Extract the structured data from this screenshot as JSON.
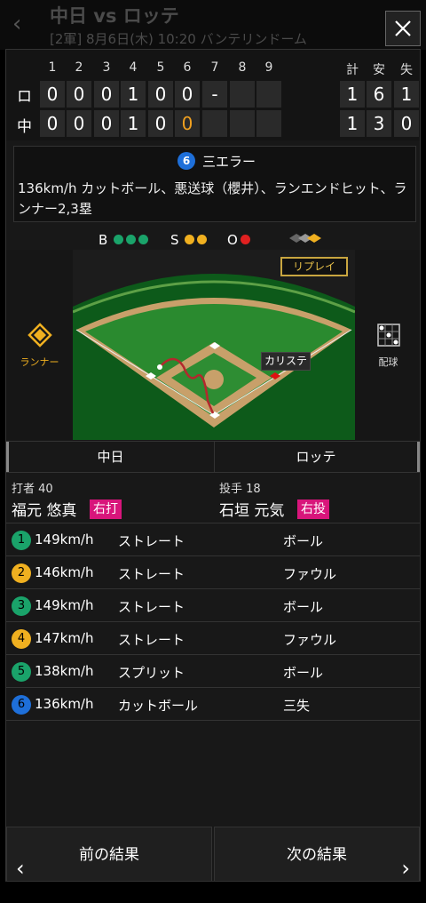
{
  "background": {
    "title": "中日 vs ロッテ",
    "subtitle": "[2軍] 8月6日(木) 10:20 バンテリンドーム",
    "back_icon": "chevron-left-icon"
  },
  "close_label": "×",
  "scoreboard": {
    "innings": [
      "1",
      "2",
      "3",
      "4",
      "5",
      "6",
      "7",
      "8",
      "9"
    ],
    "totals_headers": [
      "計",
      "安",
      "失"
    ],
    "teams": [
      {
        "abbr": "ロ",
        "scores": [
          "0",
          "0",
          "0",
          "1",
          "0",
          "0",
          "-",
          "",
          ""
        ],
        "totals": [
          "1",
          "6",
          "1"
        ]
      },
      {
        "abbr": "中",
        "scores": [
          "0",
          "0",
          "0",
          "1",
          "0",
          "0",
          "",
          "",
          ""
        ],
        "totals": [
          "1",
          "3",
          "0"
        ],
        "highlight_index": 5
      }
    ]
  },
  "play": {
    "number": "6",
    "result": "三エラー",
    "description": "136km/h カットボール、悪送球（櫻井）、ランエンドヒット、ランナー2,3塁"
  },
  "count": {
    "b_label": "B",
    "s_label": "S",
    "o_label": "O",
    "balls": 3,
    "strikes": 2,
    "outs": 1
  },
  "field": {
    "replay_label": "リプレイ",
    "runner_label": "ランナー",
    "pitch_chart_label": "配球",
    "fielder_tag": "カリステ"
  },
  "tabs": [
    "中日",
    "ロッテ"
  ],
  "batter": {
    "role": "打者",
    "number": "40",
    "name": "福元 悠真",
    "hand": "右打"
  },
  "pitcher": {
    "role": "投手",
    "number": "18",
    "name": "石垣 元気",
    "hand": "右投"
  },
  "pitches": [
    {
      "num": "1",
      "speed": "149km/h",
      "type": "ストレート",
      "result": "ボール",
      "color": "#1aa36a"
    },
    {
      "num": "2",
      "speed": "146km/h",
      "type": "ストレート",
      "result": "ファウル",
      "color": "#f0b020"
    },
    {
      "num": "3",
      "speed": "149km/h",
      "type": "ストレート",
      "result": "ボール",
      "color": "#1aa36a"
    },
    {
      "num": "4",
      "speed": "147km/h",
      "type": "ストレート",
      "result": "ファウル",
      "color": "#f0b020"
    },
    {
      "num": "5",
      "speed": "138km/h",
      "type": "スプリット",
      "result": "ボール",
      "color": "#1aa36a"
    },
    {
      "num": "6",
      "speed": "136km/h",
      "type": "カットボール",
      "result": "三失",
      "color": "#1e6fd9"
    }
  ],
  "footer": {
    "prev_label": "前の結果",
    "next_label": "次の結果"
  }
}
